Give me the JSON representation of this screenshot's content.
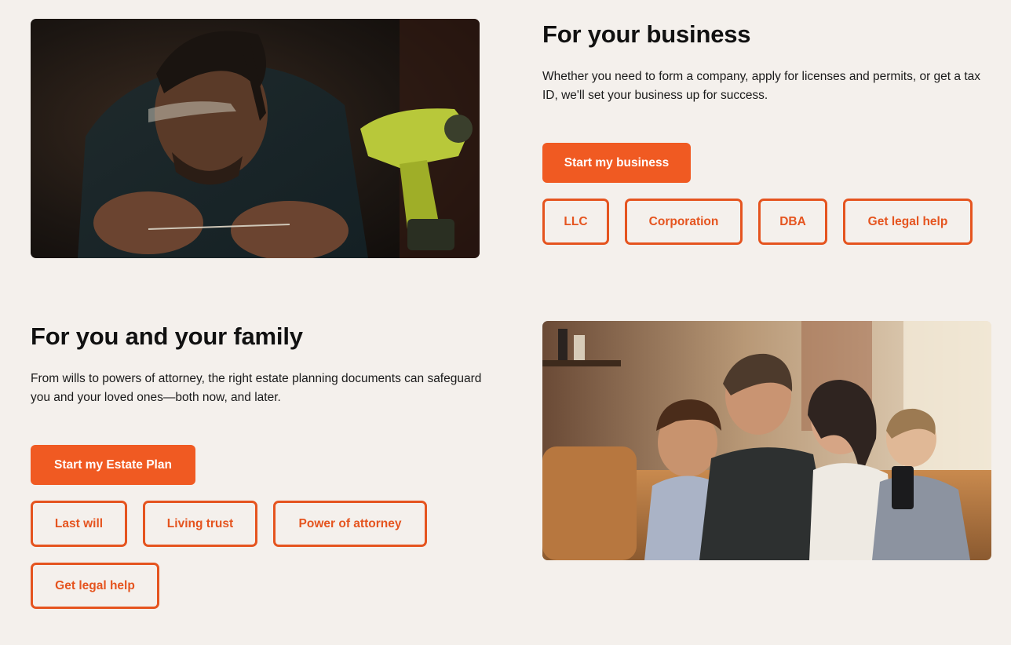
{
  "business": {
    "heading": "For your business",
    "description": "Whether you need to form a company, apply for licenses and permits, or get a tax ID, we'll set your business up for success.",
    "primary_button": "Start my business",
    "links": [
      "LLC",
      "Corporation",
      "DBA",
      "Get legal help"
    ]
  },
  "family": {
    "heading": "For you and your family",
    "description": "From wills to powers of attorney, the right estate planning documents can safeguard you and your loved ones—both now, and later.",
    "primary_button": "Start my Estate Plan",
    "links": [
      "Last will",
      "Living trust",
      "Power of attorney",
      "Get legal help"
    ]
  },
  "colors": {
    "accent": "#f05a22",
    "accent_outline": "#e5541f",
    "background": "#f4f0ec",
    "text": "#111111"
  }
}
